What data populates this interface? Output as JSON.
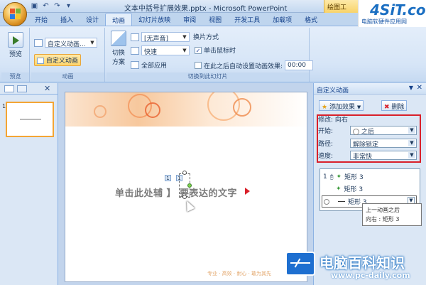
{
  "window": {
    "title": "文本中括号扩展效果.pptx - Microsoft PowerPoint",
    "contextual_tab": "绘图工"
  },
  "tabs": [
    "开始",
    "插入",
    "设计",
    "动画",
    "幻灯片放映",
    "审阅",
    "视图",
    "开发工具",
    "加载项",
    "格式"
  ],
  "active_tab": "动画",
  "ribbon": {
    "preview": {
      "button": "预览",
      "group": "预览"
    },
    "animation": {
      "effect_combo": "自定义动画...",
      "custom_anim_button": "自定义动画",
      "group": "动画"
    },
    "transition": {
      "switch_scheme_line1": "切换",
      "switch_scheme_line2": "方案",
      "sound": "[无声音]",
      "speed": "快速",
      "apply_all": "全部应用",
      "switch_mode_label": "换片方式",
      "on_click": "单击鼠标时",
      "auto_after": "在此之后自动设置动画效果:",
      "time": "00:00",
      "group": "切换到此幻灯片"
    }
  },
  "slide": {
    "text": "单击此处辅 】 要表达的文字",
    "anim_tag_1": "1",
    "anim_tag_2": "1",
    "footer": "专业 · 高效 · 耐心 · 敢为其先"
  },
  "thumbnail": {
    "number": "1"
  },
  "task_pane": {
    "title": "自定义动画",
    "add_effect": "添加效果",
    "remove": "删除",
    "modify_label": "修改: 向右",
    "start_label": "开始:",
    "start_value": "之后",
    "path_label": "路径:",
    "path_value": "解除锁定",
    "speed_label": "速度:",
    "speed_value": "非常快",
    "items": [
      {
        "index": "1",
        "name": "矩形 3"
      },
      {
        "index": "",
        "name": "矩形 3"
      },
      {
        "index": "",
        "name": "矩形 3"
      }
    ],
    "tooltip_line1": "上一动画之后",
    "tooltip_line2": "向右 : 矩形 3"
  },
  "watermark": {
    "top_logo": "4SiT.com",
    "top_sub": "电脑软硬件应用网",
    "bottom_title": "电脑百科知识",
    "bottom_url": "www.pc-daily.com"
  },
  "colors": {
    "accent_orange": "#f4a534",
    "highlight_red": "#d9202a",
    "ribbon_blue": "#d6e5f7"
  }
}
